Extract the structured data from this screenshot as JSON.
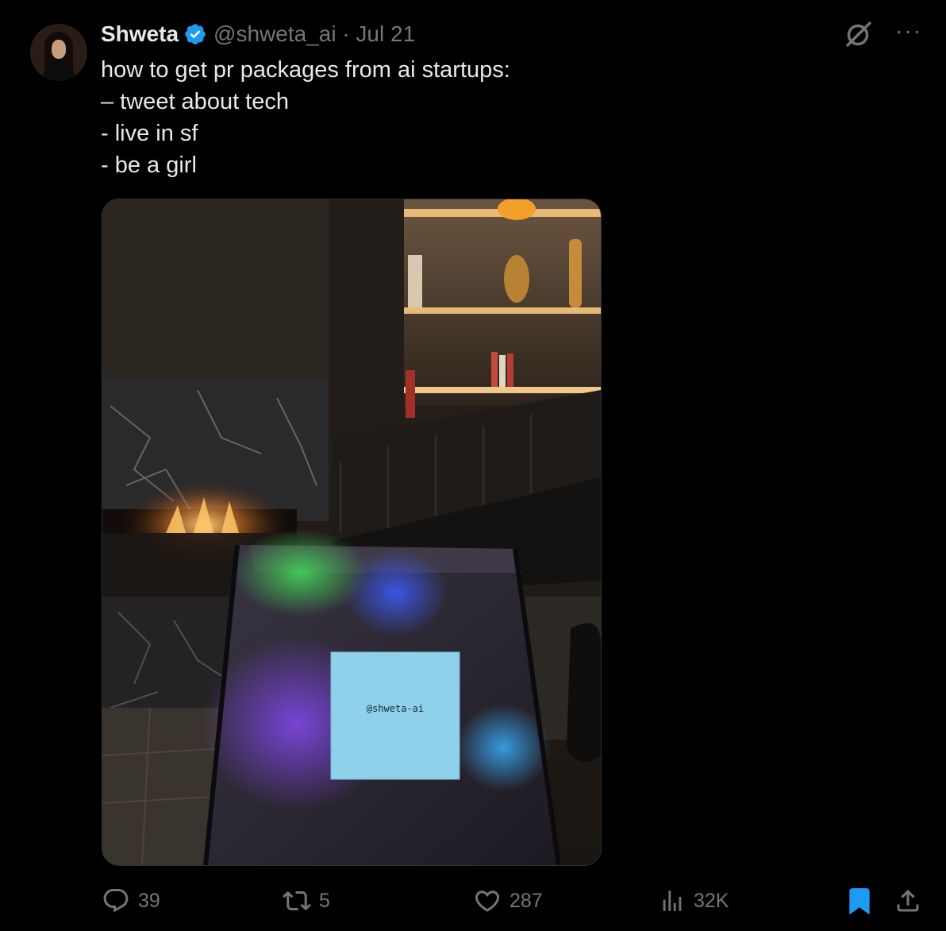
{
  "tweet": {
    "author_name": "Shweta",
    "handle_line": "@shweta_ai · Jul 21",
    "lines": [
      "how to get pr packages from ai startups:",
      "– tweet about tech",
      "- live in sf",
      "- be a girl"
    ],
    "note_text": "@shweta-ai"
  },
  "icons": {
    "verified": "verified-badge-icon",
    "grok": "grok-icon",
    "more": "more-icon",
    "reply": "reply-icon",
    "retweet": "retweet-icon",
    "like": "heart-icon",
    "views": "views-icon",
    "bookmark": "bookmark-icon",
    "share": "share-icon"
  },
  "actions": {
    "reply_count": "39",
    "retweet_count": "5",
    "like_count": "287",
    "view_count": "32K"
  },
  "colors": {
    "background": "#000000",
    "text": "#e7e9ea",
    "muted": "#71767b",
    "accent": "#1d9bf0"
  }
}
